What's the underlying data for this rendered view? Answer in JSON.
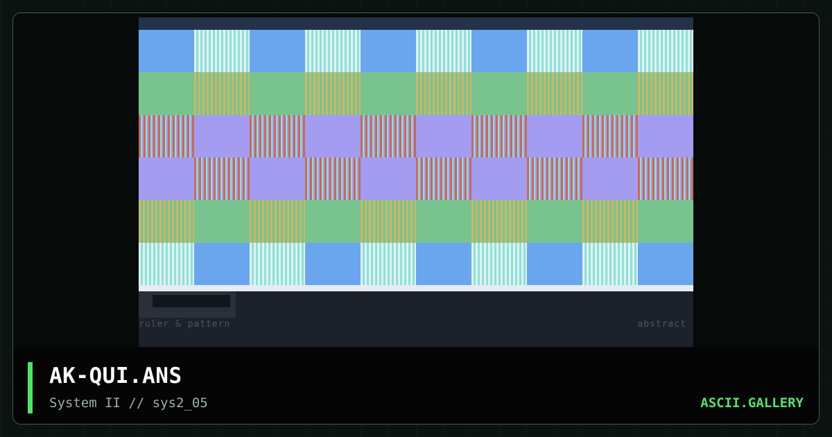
{
  "card": {
    "title": "AK-QUI.ANS",
    "subtitle": "System II // sys2_05",
    "site": "ASCII.GALLERY"
  },
  "artwork": {
    "caption_left": "ruler & pattern",
    "caption_right": "abstract",
    "palette": {
      "blue": "#6aa6ee",
      "white_stripe": "#dff2f2",
      "cyan_stripe": "#8fe0d8",
      "green": "#79c38f",
      "mustard_stripe": "#c9b86a",
      "purple": "#a49cf0",
      "red_stripe": "#c66a5c"
    },
    "rows": [
      [
        "blue",
        "ws",
        "blue",
        "ws",
        "blue",
        "ws",
        "blue",
        "ws",
        "blue",
        "ws"
      ],
      [
        "green",
        "ms",
        "green",
        "ms",
        "green",
        "ms",
        "green",
        "ms",
        "green",
        "ms"
      ],
      [
        "rs",
        "purple",
        "rs",
        "purple",
        "rs",
        "purple",
        "rs",
        "purple",
        "rs",
        "purple"
      ],
      [
        "purple",
        "rs",
        "purple",
        "rs",
        "purple",
        "rs",
        "purple",
        "rs",
        "purple",
        "rs"
      ],
      [
        "ms",
        "green",
        "ms",
        "green",
        "ms",
        "green",
        "ms",
        "green",
        "ms",
        "green"
      ],
      [
        "ws",
        "blue",
        "ws",
        "blue",
        "ws",
        "blue",
        "ws",
        "blue",
        "ws",
        "blue"
      ]
    ]
  },
  "accent": "#4ee36a",
  "frame_border": "#2f6b3c"
}
